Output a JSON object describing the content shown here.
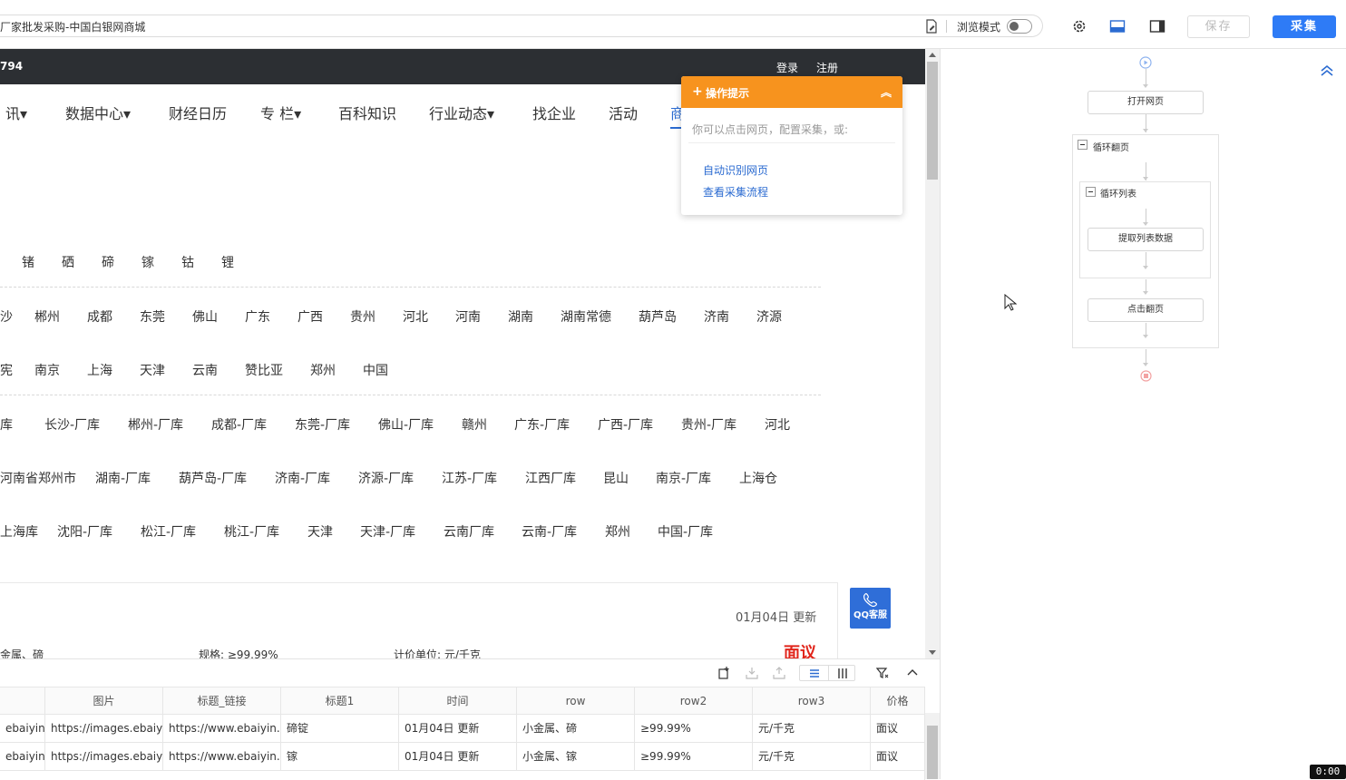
{
  "toolbar": {
    "url_title": "厂家批发采购-中国白银网商城",
    "browse_mode_label": "浏览模式",
    "save_label": "保存",
    "collect_label": "采集"
  },
  "site": {
    "topbar_number": "794",
    "login": "登录",
    "register": "注册",
    "nav": [
      "讯▾",
      "数据中心▾",
      "财经日历",
      "专 栏▾",
      "百科知识",
      "行业动态▾",
      "找企业",
      "活动",
      "商"
    ],
    "elements_row": [
      "锗",
      "硒",
      "碲",
      "镓",
      "钴",
      "锂"
    ],
    "city_row1": [
      "沙",
      "郴州",
      "成都",
      "东莞",
      "佛山",
      "广东",
      "广西",
      "贵州",
      "河北",
      "河南",
      "湖南",
      "湖南常德",
      "葫芦岛",
      "济南",
      "济源"
    ],
    "city_row2": [
      "宪",
      "南京",
      "上海",
      "天津",
      "云南",
      "赞比亚",
      "郑州",
      "中国"
    ],
    "warehouse_row1": [
      "库",
      "长沙-厂库",
      "郴州-厂库",
      "成都-厂库",
      "东莞-厂库",
      "佛山-厂库",
      "赣州",
      "广东-厂库",
      "广西-厂库",
      "贵州-厂库",
      "河北"
    ],
    "warehouse_row2": [
      "河南省郑州市",
      "湖南-厂库",
      "葫芦岛-厂库",
      "济南-厂库",
      "济源-厂库",
      "江苏-厂库",
      "江西厂库",
      "昆山",
      "南京-厂库",
      "上海仓"
    ],
    "warehouse_row3": [
      "上海库",
      "沈阳-厂库",
      "松江-厂库",
      "桃江-厂库",
      "天津",
      "天津-厂库",
      "云南厂库",
      "云南-厂库",
      "郑州",
      "中国-厂库"
    ],
    "card": {
      "update": "01月04日 更新",
      "metal": "金属、碲",
      "spec": "规格:  ≥99.99%",
      "unit": "计价单位:  元/千克",
      "price": "面议"
    },
    "qq_label": "QQ客服"
  },
  "tip": {
    "title": "操作提示",
    "desc": "你可以点击网页，配置采集，或:",
    "link1": "自动识别网页",
    "link2": "查看采集流程"
  },
  "grid": {
    "headers": [
      "",
      "图片",
      "标题_链接",
      "标题1",
      "时间",
      "row",
      "row2",
      "row3",
      "价格"
    ],
    "rows": [
      [
        "ebaiyin.c...",
        "https://images.ebaiyi...",
        "https://www.ebaiyin.c...",
        "碲锭",
        "01月04日 更新",
        "小金属、碲",
        "≥99.99%",
        "元/千克",
        "面议"
      ],
      [
        "ebaiyin.c...",
        "https://images.ebaiyi...",
        "https://www.ebaiyin.c...",
        "镓",
        "01月04日 更新",
        "小金属、镓",
        "≥99.99%",
        "元/千克",
        "面议"
      ]
    ]
  },
  "flow": {
    "open_page": "打开网页",
    "loop_page": "循环翻页",
    "loop_list": "循环列表",
    "extract": "提取列表数据",
    "click_next": "点击翻页"
  },
  "timer": "0:00"
}
